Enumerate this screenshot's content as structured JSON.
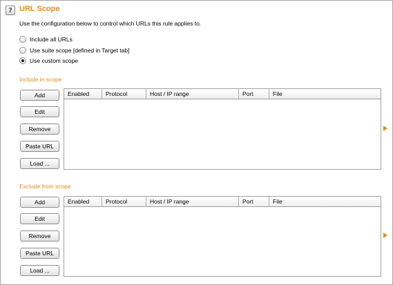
{
  "header": {
    "title": "URL Scope",
    "help_label": "?"
  },
  "description": "Use the configuration below to control which URLs this rule applies to.",
  "scope_options": [
    {
      "label": "Include all URLs",
      "checked": false
    },
    {
      "label": "Use suite scope [defined in Target tab]",
      "checked": false
    },
    {
      "label": "Use custom scope",
      "checked": true
    }
  ],
  "include": {
    "title": "Include in scope",
    "buttons": [
      "Add",
      "Edit",
      "Remove",
      "Paste URL",
      "Load ..."
    ],
    "columns": [
      "Enabled",
      "Protocol",
      "Host / IP range",
      "Port",
      "File"
    ],
    "rows": []
  },
  "exclude": {
    "title": "Exclude from scope",
    "buttons": [
      "Add",
      "Edit",
      "Remove",
      "Paste URL",
      "Load ..."
    ],
    "columns": [
      "Enabled",
      "Protocol",
      "Host / IP range",
      "Port",
      "File"
    ],
    "rows": []
  },
  "colors": {
    "accent": "#e58a1b",
    "border": "#a0a0a0"
  },
  "icons": {
    "help": "help-icon",
    "expand": "expand-arrow-icon"
  }
}
